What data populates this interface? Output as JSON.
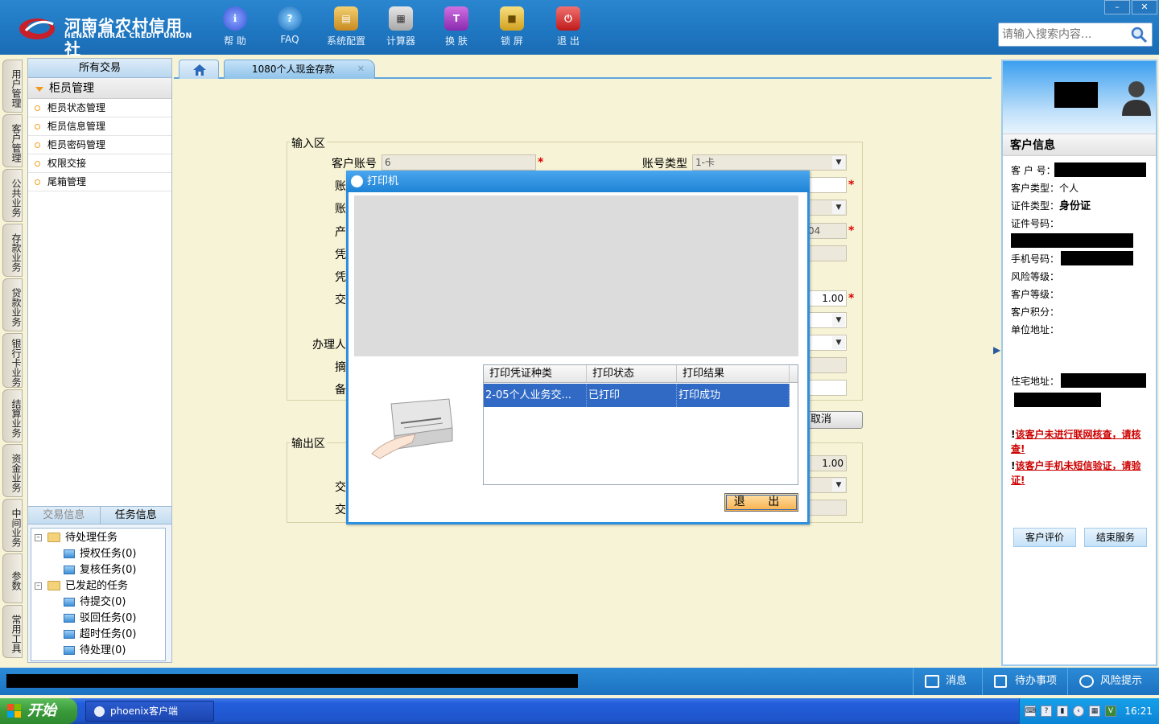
{
  "header": {
    "logo_cn": "河南省农村信用社",
    "logo_en": "HENAN RURAL CREDIT UNION",
    "toolbar": [
      {
        "label": "帮 助",
        "icon": "info-icon"
      },
      {
        "label": "FAQ",
        "icon": "faq-icon"
      },
      {
        "label": "系统配置",
        "icon": "toolbox-icon"
      },
      {
        "label": "计算器",
        "icon": "calculator-icon"
      },
      {
        "label": "换 肤",
        "icon": "shirt-icon"
      },
      {
        "label": "锁 屏",
        "icon": "lock-icon"
      },
      {
        "label": "退 出",
        "icon": "power-icon"
      }
    ],
    "window_controls": {
      "minimize": "–",
      "close": "✕"
    },
    "search_placeholder": "请输入搜索内容..."
  },
  "vertical_tabs": [
    "用户管理",
    "客户管理",
    "公共业务",
    "存款业务",
    "贷款业务",
    "银行卡业务",
    "结算业务",
    "资金业务",
    "中间业务",
    "参数",
    "常用工具"
  ],
  "left_panel": {
    "header": "所有交易",
    "group": "柜员管理",
    "items": [
      "柜员状态管理",
      "柜员信息管理",
      "柜员密码管理",
      "权限交接",
      "尾箱管理"
    ],
    "lower_tabs": [
      "交易信息",
      "任务信息"
    ],
    "tree": {
      "pending": "待处理任务",
      "pending_children": [
        "授权任务(0)",
        "复核任务(0)"
      ],
      "initiated": "已发起的任务",
      "initiated_children": [
        "待提交(0)",
        "驳回任务(0)",
        "超时任务(0)",
        "待处理(0)"
      ]
    }
  },
  "tabs": {
    "active_tab": "1080个人现金存款",
    "close": "✕"
  },
  "form": {
    "input_section": "输入区",
    "output_section": "输出区",
    "labels": {
      "account_no": "客户账号",
      "account_type": "账号类型",
      "r2": "账",
      "r3": "账",
      "r4": "产",
      "r5": "凭",
      "r6": "凭",
      "r7": "交",
      "r9": "办理人",
      "r10": "摘",
      "r11": "备",
      "o2": "交",
      "o3": "交"
    },
    "values": {
      "account_no": "6",
      "account_type": "1-卡",
      "product_code": "04",
      "amount": "1.00",
      "output_amount": "1.00"
    },
    "required_mark": "*",
    "cancel_button": "取消"
  },
  "dialog": {
    "title": "打印机",
    "columns": [
      "打印凭证种类",
      "打印状态",
      "打印结果"
    ],
    "rows": [
      {
        "type": "2-05个人业务交...",
        "status": "已打印",
        "result": "打印成功"
      }
    ],
    "exit_button": "退 出"
  },
  "right_panel": {
    "title": "客户信息",
    "fields": {
      "customer_no": "客 户 号：",
      "customer_type_label": "客户类型：",
      "customer_type": "个人",
      "id_type_label": "证件类型：",
      "id_type": "身份证",
      "id_no": "证件号码：",
      "phone": "手机号码：",
      "risk_level": "风险等级：",
      "customer_level": "客户等级：",
      "points": "客户积分：",
      "company_addr": "单位地址：",
      "home_addr": "住宅地址："
    },
    "warnings": [
      {
        "bang": "!",
        "text": "该客户未进行联网核查，请核查!"
      },
      {
        "bang": "!",
        "text": "该客户手机未短信验证，请验证!"
      }
    ],
    "buttons": [
      "客户评价",
      "结束服务"
    ]
  },
  "status_bar": {
    "items": [
      "消息",
      "待办事项",
      "风险提示"
    ]
  },
  "taskbar": {
    "start": "开始",
    "task": "phoenix客户端",
    "clock": "16:21"
  },
  "colors": {
    "header_blue": "#1f76c0",
    "workspace_bg": "#f7f3d6",
    "selection_blue": "#316ac5",
    "required_red": "#dd0000"
  }
}
